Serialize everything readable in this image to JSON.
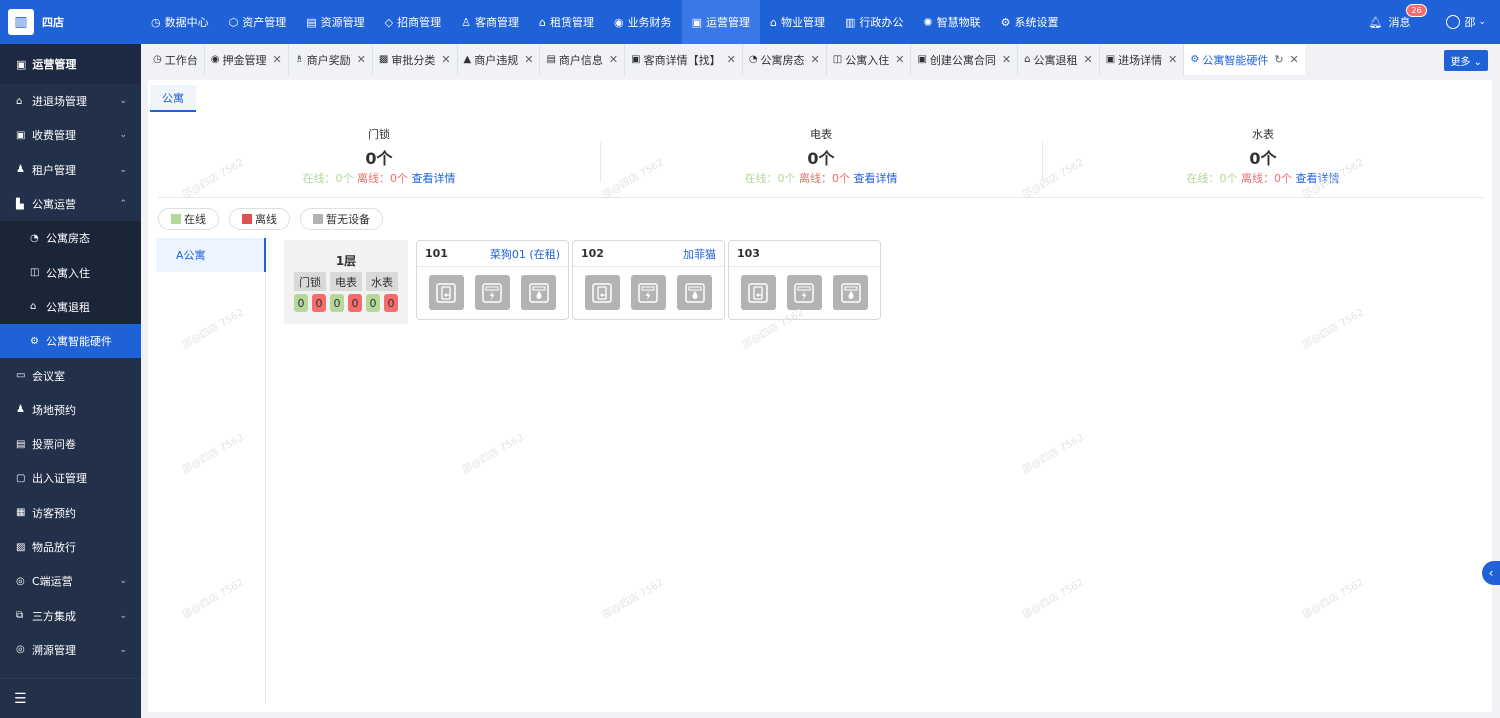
{
  "brand": {
    "name": "四店"
  },
  "topnav": [
    {
      "icon": "◷",
      "label": "数据中心"
    },
    {
      "icon": "⬡",
      "label": "资产管理"
    },
    {
      "icon": "▤",
      "label": "资源管理"
    },
    {
      "icon": "◇",
      "label": "招商管理"
    },
    {
      "icon": "♙",
      "label": "客商管理"
    },
    {
      "icon": "⌂",
      "label": "租赁管理"
    },
    {
      "icon": "◉",
      "label": "业务财务"
    },
    {
      "icon": "▣",
      "label": "运营管理"
    },
    {
      "icon": "⌂",
      "label": "物业管理"
    },
    {
      "icon": "▥",
      "label": "行政办公"
    },
    {
      "icon": "✺",
      "label": "智慧物联"
    },
    {
      "icon": "⚙",
      "label": "系统设置"
    }
  ],
  "header": {
    "messages_label": "消息",
    "messages_count": "26",
    "user_name": "邵"
  },
  "sidebar": {
    "title": "运营管理",
    "items": [
      {
        "icon": "⌂",
        "label": "进退场管理",
        "arrow": "⌄"
      },
      {
        "icon": "▣",
        "label": "收费管理",
        "arrow": "⌄"
      },
      {
        "icon": "♟",
        "label": "租户管理",
        "arrow": "⌄"
      },
      {
        "icon": "▙",
        "label": "公寓运营",
        "arrow": "⌃"
      }
    ],
    "subitems": [
      {
        "icon": "◔",
        "label": "公寓房态"
      },
      {
        "icon": "◫",
        "label": "公寓入住"
      },
      {
        "icon": "⌂",
        "label": "公寓退租"
      },
      {
        "icon": "⚙",
        "label": "公寓智能硬件"
      }
    ],
    "items2": [
      {
        "icon": "▭",
        "label": "会议室",
        "arrow": ""
      },
      {
        "icon": "♟",
        "label": "场地预约",
        "arrow": ""
      },
      {
        "icon": "▤",
        "label": "投票问卷",
        "arrow": ""
      },
      {
        "icon": "▢",
        "label": "出入证管理",
        "arrow": ""
      },
      {
        "icon": "▦",
        "label": "访客预约",
        "arrow": ""
      },
      {
        "icon": "▨",
        "label": "物品放行",
        "arrow": ""
      },
      {
        "icon": "◎",
        "label": "C端运营",
        "arrow": "⌄"
      },
      {
        "icon": "⧉",
        "label": "三方集成",
        "arrow": "⌄"
      },
      {
        "icon": "◎",
        "label": "溯源管理",
        "arrow": "⌄"
      }
    ],
    "collapse_icon": "☰"
  },
  "tabs": [
    {
      "icon": "◷",
      "label": "工作台",
      "close": ""
    },
    {
      "icon": "◉",
      "label": "押金管理",
      "close": "✕"
    },
    {
      "icon": "♗",
      "label": "商户奖励",
      "close": "✕"
    },
    {
      "icon": "▩",
      "label": "审批分类",
      "close": "✕"
    },
    {
      "icon": "▲",
      "label": "商户违规",
      "close": "✕"
    },
    {
      "icon": "▤",
      "label": "商户信息",
      "close": "✕"
    },
    {
      "icon": "▣",
      "label": "客商详情【找】",
      "close": "✕"
    },
    {
      "icon": "◔",
      "label": "公寓房态",
      "close": "✕"
    },
    {
      "icon": "◫",
      "label": "公寓入住",
      "close": "✕"
    },
    {
      "icon": "▣",
      "label": "创建公寓合同",
      "close": "✕"
    },
    {
      "icon": "⌂",
      "label": "公寓退租",
      "close": "✕"
    },
    {
      "icon": "▣",
      "label": "进场详情",
      "close": "✕"
    },
    {
      "icon": "⚙",
      "label": "公寓智能硬件",
      "close": "✕",
      "refresh": "↻"
    }
  ],
  "more_label": "更多 ⌄",
  "content_tab": "公寓",
  "stats": [
    {
      "label": "门锁",
      "total": "0个",
      "online_label": "在线：",
      "online": "0个",
      "offline_label": "离线：",
      "offline": "0个",
      "link": "查看详情"
    },
    {
      "label": "电表",
      "total": "0个",
      "online_label": "在线：",
      "online": "0个",
      "offline_label": "离线：",
      "offline": "0个",
      "link": "查看详情"
    },
    {
      "label": "水表",
      "total": "0个",
      "online_label": "在线：",
      "online": "0个",
      "offline_label": "离线：",
      "offline": "0个",
      "link": "查看详情"
    }
  ],
  "legend": [
    {
      "label": "在线",
      "color": "#b5d79a"
    },
    {
      "label": "离线",
      "color": "#e05050"
    },
    {
      "label": "暂无设备",
      "color": "#b3b3b3"
    }
  ],
  "buildings": [
    "A公寓"
  ],
  "floor": {
    "name": "1层",
    "headers": [
      "门锁",
      "电表",
      "水表"
    ],
    "counts": [
      "0",
      "0",
      "0",
      "0",
      "0",
      "0"
    ]
  },
  "rooms": [
    {
      "number": "101",
      "tenant": "菜狗01 (在租)"
    },
    {
      "number": "102",
      "tenant": "加菲猫"
    },
    {
      "number": "103",
      "tenant": ""
    }
  ],
  "watermark": "邵@四店 7562"
}
